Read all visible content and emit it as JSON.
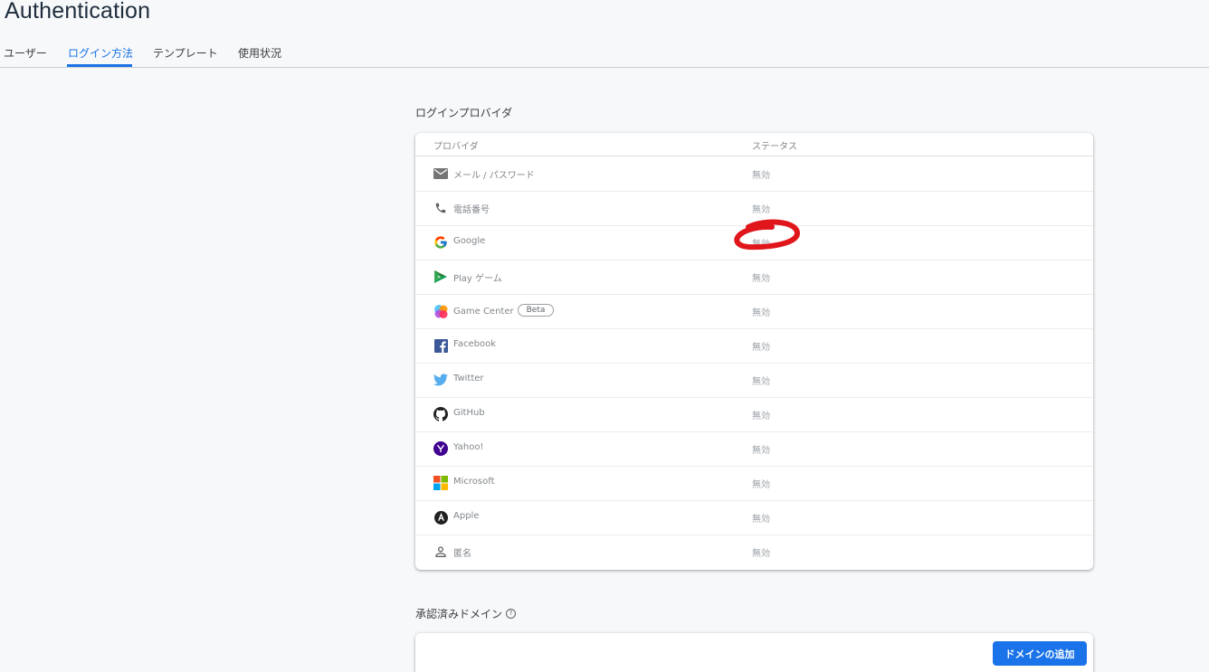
{
  "page": {
    "title": "Authentication"
  },
  "tabs": [
    {
      "label": "ユーザー",
      "active": false
    },
    {
      "label": "ログイン方法",
      "active": true
    },
    {
      "label": "テンプレート",
      "active": false
    },
    {
      "label": "使用状況",
      "active": false
    }
  ],
  "providers_section": {
    "title": "ログインプロバイダ",
    "column_provider": "プロバイダ",
    "column_status": "ステータス",
    "rows": [
      {
        "name": "メール / パスワード",
        "status": "無効",
        "icon": "mail-icon"
      },
      {
        "name": "電話番号",
        "status": "無効",
        "icon": "phone-icon"
      },
      {
        "name": "Google",
        "status": "無効",
        "icon": "google-icon"
      },
      {
        "name": "Play ゲーム",
        "status": "無効",
        "icon": "play-games-icon"
      },
      {
        "name": "Game Center",
        "status": "無効",
        "icon": "game-center-icon",
        "badge": "Beta"
      },
      {
        "name": "Facebook",
        "status": "無効",
        "icon": "facebook-icon"
      },
      {
        "name": "Twitter",
        "status": "無効",
        "icon": "twitter-icon"
      },
      {
        "name": "GitHub",
        "status": "無効",
        "icon": "github-icon"
      },
      {
        "name": "Yahoo!",
        "status": "無効",
        "icon": "yahoo-icon"
      },
      {
        "name": "Microsoft",
        "status": "無効",
        "icon": "microsoft-icon"
      },
      {
        "name": "Apple",
        "status": "無効",
        "icon": "apple-icon"
      },
      {
        "name": "匿名",
        "status": "無効",
        "icon": "anonymous-icon"
      }
    ]
  },
  "domains_section": {
    "title": "承認済みドメイン",
    "help_icon": "help-icon",
    "add_button_label": "ドメインの追加"
  },
  "colors": {
    "accent": "#1a73e8",
    "annotation": "#e0161b"
  }
}
